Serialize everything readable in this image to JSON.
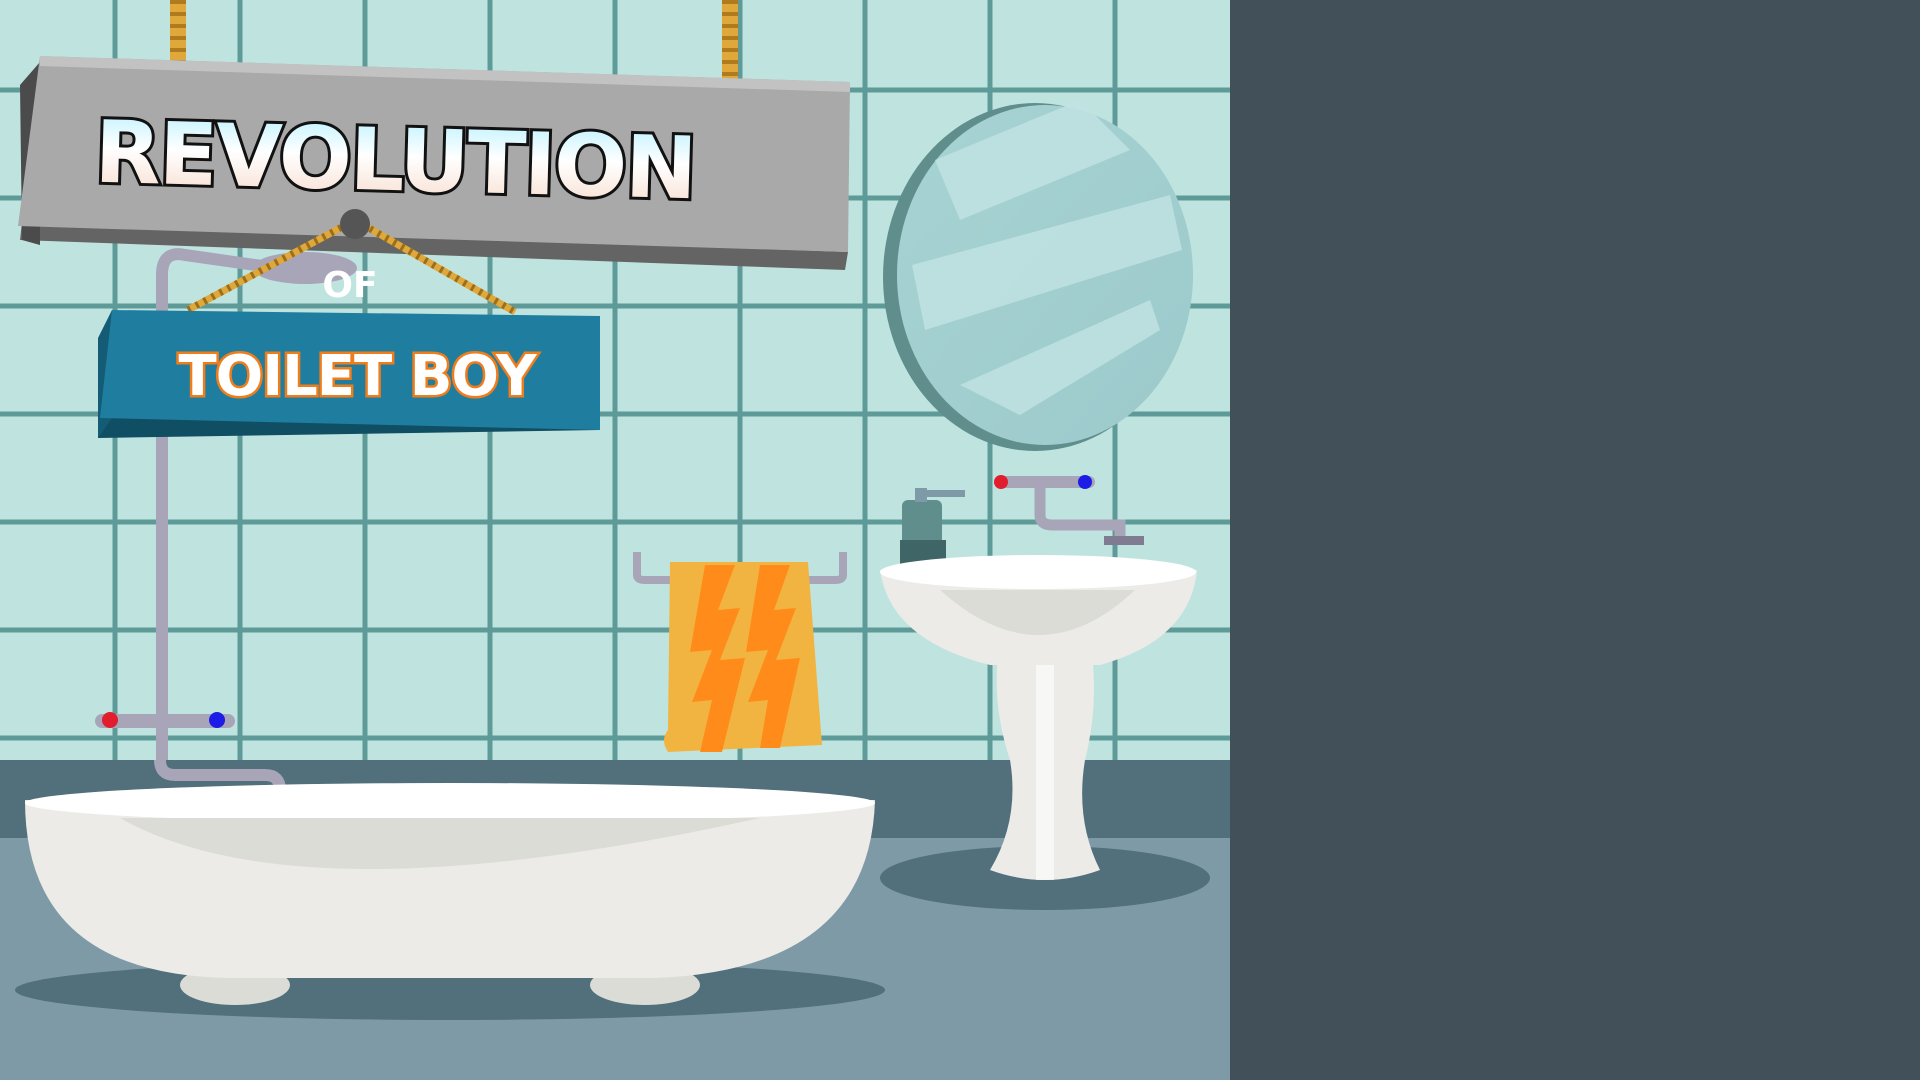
{
  "title": {
    "main": "REVOLUTION",
    "connector": "OF",
    "subtitle": "TOILET BOY"
  },
  "colors": {
    "wall_tile": "#bfe4df",
    "tile_grout": "#5e9a98",
    "floor": "#7f9aa7",
    "baseboard": "#51707b",
    "side_panel": "#425159",
    "main_sign": "#a9a9a9",
    "sub_sign": "#1f7ea0",
    "rope": "#e0a83a",
    "towel": "#f2b440",
    "towel_stripe": "#ff8c1a",
    "porcelain": "#ffffff"
  },
  "icons": [
    "shower-head-icon",
    "faucet-icon",
    "soap-dispenser-icon",
    "mirror-icon",
    "towel-icon",
    "bathtub-icon",
    "sink-icon"
  ]
}
